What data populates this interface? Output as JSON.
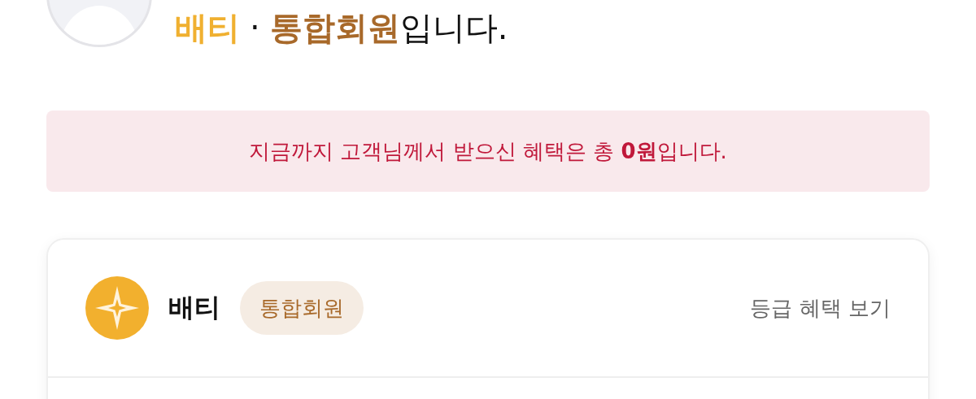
{
  "profile": {
    "grade": "배티",
    "separator": "·",
    "membership": "통합회원",
    "suffix": "입니다."
  },
  "benefit_banner": {
    "text": "지금까지 고객님께서 받으신 혜택은 총 **0원**입니다."
  },
  "grade_card": {
    "name": "배티",
    "badge": "통합회원",
    "link": "등급 혜택 보기"
  }
}
